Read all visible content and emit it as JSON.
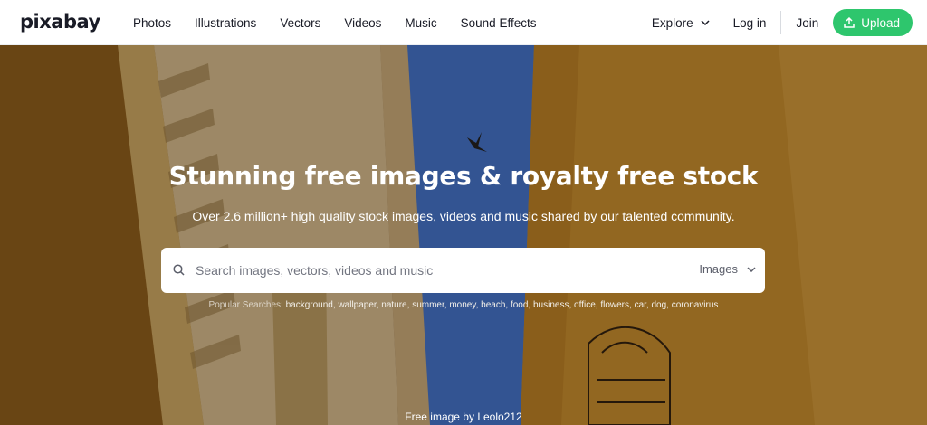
{
  "brand": {
    "logo": "pixabay"
  },
  "nav": {
    "links": [
      "Photos",
      "Illustrations",
      "Vectors",
      "Videos",
      "Music",
      "Sound Effects"
    ],
    "explore": "Explore",
    "login": "Log in",
    "join": "Join",
    "upload": "Upload"
  },
  "hero": {
    "title": "Stunning free images & royalty free stock",
    "subtitle": "Over 2.6 million+ high quality stock images, videos and music shared by our talented community.",
    "credit": "Free image by Leolo212"
  },
  "search": {
    "placeholder": "Search images, vectors, videos and music",
    "type_selected": "Images"
  },
  "popular": {
    "label": "Popular Searches:",
    "terms": [
      "background",
      "wallpaper",
      "nature",
      "summer",
      "money",
      "beach",
      "food",
      "business",
      "office",
      "flowers",
      "car",
      "dog",
      "coronavirus"
    ]
  },
  "colors": {
    "accent": "#2ec66d",
    "text": "#191b26"
  },
  "icons": {
    "search": "search-icon",
    "chevron": "chevron-down-icon",
    "upload": "upload-icon"
  }
}
